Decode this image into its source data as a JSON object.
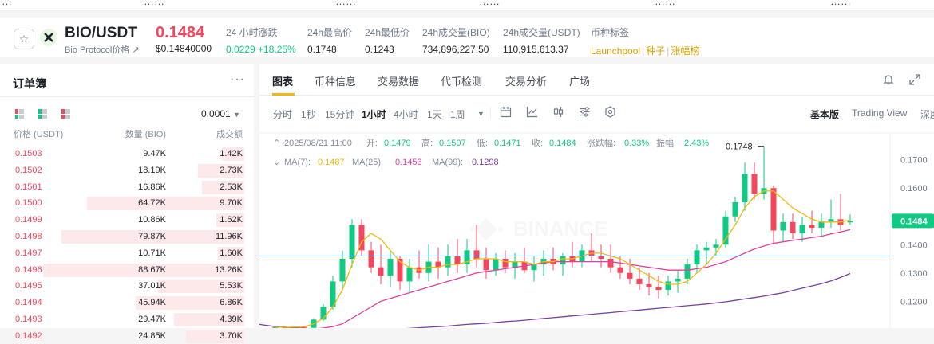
{
  "top_strip": [
    "…",
    "……",
    "……",
    "……",
    "……",
    "……"
  ],
  "ticker": {
    "pair": "BIO/USDT",
    "name": "Bio Protocol价格",
    "name_arrow": "↗",
    "last_price": "0.1484",
    "last_price_usd": "$0.14840000",
    "stats": [
      {
        "label": "24 小时涨跌",
        "value": "0.0229 +18.25%",
        "color": "green"
      },
      {
        "label": "24h最高价",
        "value": "0.1748"
      },
      {
        "label": "24h最低价",
        "value": "0.1243"
      },
      {
        "label": "24h成交量(BIO)",
        "value": "734,896,227.50"
      },
      {
        "label": "24h成交量(USDT)",
        "value": "110,915,613.37"
      }
    ],
    "tags_label": "币种标签",
    "tags": [
      "Launchpool",
      "种子",
      "涨幅榜"
    ]
  },
  "orderbook": {
    "title": "订单簿",
    "more_icon": "more-dots-icon",
    "precision": "0.0001",
    "col_price": "价格 (USDT)",
    "col_qty": "数量 (BIO)",
    "col_total": "成交额",
    "asks": [
      {
        "price": "0.1503",
        "qty": "9.47K",
        "total": "1.42K",
        "depth": 0.11
      },
      {
        "price": "0.1502",
        "qty": "18.19K",
        "total": "2.73K",
        "depth": 0.23
      },
      {
        "price": "0.1501",
        "qty": "16.86K",
        "total": "2.53K",
        "depth": 0.21
      },
      {
        "price": "0.1500",
        "qty": "64.72K",
        "total": "9.70K",
        "depth": 0.78
      },
      {
        "price": "0.1499",
        "qty": "10.86K",
        "total": "1.62K",
        "depth": 0.14
      },
      {
        "price": "0.1498",
        "qty": "79.87K",
        "total": "11.96K",
        "depth": 0.91
      },
      {
        "price": "0.1497",
        "qty": "10.71K",
        "total": "1.60K",
        "depth": 0.13
      },
      {
        "price": "0.1496",
        "qty": "88.67K",
        "total": "13.26K",
        "depth": 1.0
      },
      {
        "price": "0.1495",
        "qty": "37.01K",
        "total": "5.53K",
        "depth": 0.43
      },
      {
        "price": "0.1494",
        "qty": "45.94K",
        "total": "6.86K",
        "depth": 0.54
      },
      {
        "price": "0.1493",
        "qty": "29.47K",
        "total": "4.39K",
        "depth": 0.35
      },
      {
        "price": "0.1492",
        "qty": "24.85K",
        "total": "3.70K",
        "depth": 0.29
      }
    ]
  },
  "chart_panel": {
    "tabs": [
      "图表",
      "币种信息",
      "交易数据",
      "代币检测",
      "交易分析",
      "广场"
    ],
    "active_tab": "图表",
    "intervals": [
      "分时",
      "1秒",
      "15分钟",
      "1小时",
      "4小时",
      "1天",
      "1周"
    ],
    "active_interval": "1小时",
    "views": [
      "基本版",
      "Trading View",
      "深度"
    ],
    "active_view": "基本版"
  },
  "chart_data": {
    "type": "candlestick",
    "ohlc_line": {
      "date": "2025/08/21 11:00",
      "open_label": "开:",
      "open": "0.1479",
      "high_label": "高:",
      "high": "0.1507",
      "low_label": "低:",
      "low": "0.1471",
      "close_label": "收:",
      "close": "0.1484",
      "change_label": "涨跌幅:",
      "change": "0.33%",
      "amp_label": "振幅:",
      "amp": "2.43%"
    },
    "ma_line": {
      "ma7_label": "MA(7):",
      "ma7": "0.1487",
      "ma25_label": "MA(25):",
      "ma25": "0.1453",
      "ma99_label": "MA(99):",
      "ma99": "0.1298"
    },
    "y_ticks": [
      "0.1700",
      "0.1600",
      "0.1400",
      "0.1300",
      "0.1200"
    ],
    "y_tick_values": [
      0.17,
      0.16,
      0.14,
      0.13,
      0.12
    ],
    "ylim": [
      0.1105,
      0.1795
    ],
    "current_price_label": "0.1484",
    "current_price": 0.1484,
    "high_marker_label": "0.1748",
    "high_marker_value": 0.1748,
    "hline_value": 0.136,
    "candles": [
      [
        0.1105,
        0.111,
        0.11,
        0.1108
      ],
      [
        0.1108,
        0.1112,
        0.1102,
        0.1104
      ],
      [
        0.1104,
        0.1111,
        0.11,
        0.1109
      ],
      [
        0.1109,
        0.1113,
        0.1104,
        0.1106
      ],
      [
        0.1106,
        0.114,
        0.1104,
        0.1135
      ],
      [
        0.1135,
        0.119,
        0.113,
        0.118
      ],
      [
        0.118,
        0.129,
        0.117,
        0.127
      ],
      [
        0.127,
        0.138,
        0.124,
        0.135
      ],
      [
        0.135,
        0.149,
        0.132,
        0.147
      ],
      [
        0.147,
        0.149,
        0.136,
        0.138
      ],
      [
        0.138,
        0.141,
        0.13,
        0.132
      ],
      [
        0.132,
        0.14,
        0.126,
        0.129
      ],
      [
        0.129,
        0.138,
        0.125,
        0.135
      ],
      [
        0.135,
        0.136,
        0.124,
        0.127
      ],
      [
        0.127,
        0.135,
        0.123,
        0.132
      ],
      [
        0.132,
        0.138,
        0.128,
        0.13
      ],
      [
        0.13,
        0.14,
        0.127,
        0.134
      ],
      [
        0.134,
        0.139,
        0.128,
        0.132
      ],
      [
        0.132,
        0.14,
        0.129,
        0.136
      ],
      [
        0.136,
        0.142,
        0.13,
        0.133
      ],
      [
        0.133,
        0.142,
        0.13,
        0.138
      ],
      [
        0.138,
        0.147,
        0.132,
        0.135
      ],
      [
        0.135,
        0.139,
        0.128,
        0.131
      ],
      [
        0.131,
        0.137,
        0.129,
        0.135
      ],
      [
        0.135,
        0.138,
        0.13,
        0.132
      ],
      [
        0.132,
        0.137,
        0.128,
        0.134
      ],
      [
        0.134,
        0.139,
        0.13,
        0.131
      ],
      [
        0.131,
        0.136,
        0.127,
        0.133
      ],
      [
        0.133,
        0.138,
        0.129,
        0.135
      ],
      [
        0.135,
        0.139,
        0.131,
        0.133
      ],
      [
        0.133,
        0.137,
        0.129,
        0.136
      ],
      [
        0.136,
        0.141,
        0.132,
        0.134
      ],
      [
        0.134,
        0.14,
        0.132,
        0.138
      ],
      [
        0.138,
        0.144,
        0.134,
        0.136
      ],
      [
        0.136,
        0.14,
        0.132,
        0.135
      ],
      [
        0.135,
        0.14,
        0.13,
        0.132
      ],
      [
        0.132,
        0.136,
        0.128,
        0.13
      ],
      [
        0.13,
        0.135,
        0.126,
        0.128
      ],
      [
        0.128,
        0.132,
        0.124,
        0.126
      ],
      [
        0.126,
        0.13,
        0.122,
        0.125
      ],
      [
        0.125,
        0.129,
        0.121,
        0.124
      ],
      [
        0.124,
        0.129,
        0.122,
        0.127
      ],
      [
        0.127,
        0.131,
        0.123,
        0.128
      ],
      [
        0.128,
        0.135,
        0.126,
        0.133
      ],
      [
        0.133,
        0.14,
        0.13,
        0.138
      ],
      [
        0.138,
        0.141,
        0.133,
        0.139
      ],
      [
        0.139,
        0.142,
        0.136,
        0.14
      ],
      [
        0.14,
        0.152,
        0.139,
        0.15
      ],
      [
        0.15,
        0.157,
        0.148,
        0.155
      ],
      [
        0.155,
        0.169,
        0.152,
        0.165
      ],
      [
        0.165,
        0.169,
        0.156,
        0.158
      ],
      [
        0.158,
        0.1748,
        0.156,
        0.16
      ],
      [
        0.16,
        0.161,
        0.14,
        0.145
      ],
      [
        0.145,
        0.151,
        0.141,
        0.148
      ],
      [
        0.148,
        0.151,
        0.142,
        0.144
      ],
      [
        0.144,
        0.15,
        0.141,
        0.147
      ],
      [
        0.147,
        0.152,
        0.144,
        0.146
      ],
      [
        0.146,
        0.151,
        0.143,
        0.148
      ],
      [
        0.148,
        0.156,
        0.146,
        0.149
      ],
      [
        0.149,
        0.158,
        0.145,
        0.147
      ],
      [
        0.1479,
        0.1507,
        0.1471,
        0.1484
      ]
    ],
    "ma7": [
      0.1108,
      0.1108,
      0.1108,
      0.111,
      0.112,
      0.114,
      0.118,
      0.124,
      0.133,
      0.141,
      0.144,
      0.142,
      0.138,
      0.134,
      0.132,
      0.131,
      0.132,
      0.132,
      0.133,
      0.133,
      0.134,
      0.135,
      0.135,
      0.135,
      0.134,
      0.134,
      0.134,
      0.133,
      0.134,
      0.134,
      0.135,
      0.135,
      0.136,
      0.137,
      0.137,
      0.136,
      0.135,
      0.133,
      0.131,
      0.129,
      0.127,
      0.126,
      0.126,
      0.127,
      0.13,
      0.133,
      0.137,
      0.142,
      0.147,
      0.153,
      0.157,
      0.159,
      0.159,
      0.156,
      0.153,
      0.151,
      0.149,
      0.148,
      0.148,
      0.148,
      0.1487
    ],
    "ma25": [
      0.11,
      0.11,
      0.11,
      0.11,
      0.1102,
      0.1105,
      0.111,
      0.112,
      0.114,
      0.116,
      0.118,
      0.12,
      0.121,
      0.122,
      0.123,
      0.124,
      0.125,
      0.126,
      0.127,
      0.128,
      0.129,
      0.13,
      0.1305,
      0.131,
      0.1315,
      0.132,
      0.1325,
      0.133,
      0.1335,
      0.134,
      0.134,
      0.134,
      0.134,
      0.134,
      0.134,
      0.134,
      0.1335,
      0.133,
      0.1325,
      0.132,
      0.1315,
      0.131,
      0.131,
      0.131,
      0.1315,
      0.132,
      0.133,
      0.134,
      0.1355,
      0.137,
      0.1385,
      0.1395,
      0.1405,
      0.141,
      0.1415,
      0.142,
      0.1425,
      0.143,
      0.1438,
      0.1445,
      0.1453
    ],
    "ma99": [
      0.111,
      0.1108,
      0.1106,
      0.1104,
      0.1102,
      0.11,
      0.1098,
      0.1096,
      0.1095,
      0.1095,
      0.1096,
      0.1098,
      0.11,
      0.1102,
      0.1104,
      0.1106,
      0.1108,
      0.111,
      0.1112,
      0.1115,
      0.1118,
      0.112,
      0.1122,
      0.1125,
      0.1128,
      0.113,
      0.1133,
      0.1136,
      0.1139,
      0.1142,
      0.1145,
      0.1148,
      0.1151,
      0.1154,
      0.1157,
      0.116,
      0.1163,
      0.1166,
      0.1169,
      0.1172,
      0.1175,
      0.1178,
      0.1181,
      0.1184,
      0.1187,
      0.119,
      0.1194,
      0.1198,
      0.1203,
      0.1208,
      0.1213,
      0.1218,
      0.1224,
      0.123,
      0.1238,
      0.1246,
      0.1254,
      0.1262,
      0.1272,
      0.1284,
      0.1298
    ],
    "colors": {
      "up": "#0ecb81",
      "down": "#f6465d",
      "ma7": "#f0b90b",
      "ma25": "#e040a0",
      "ma99": "#7b3fa0",
      "hline": "#4b8ef0"
    },
    "watermark": "BINANCE"
  }
}
